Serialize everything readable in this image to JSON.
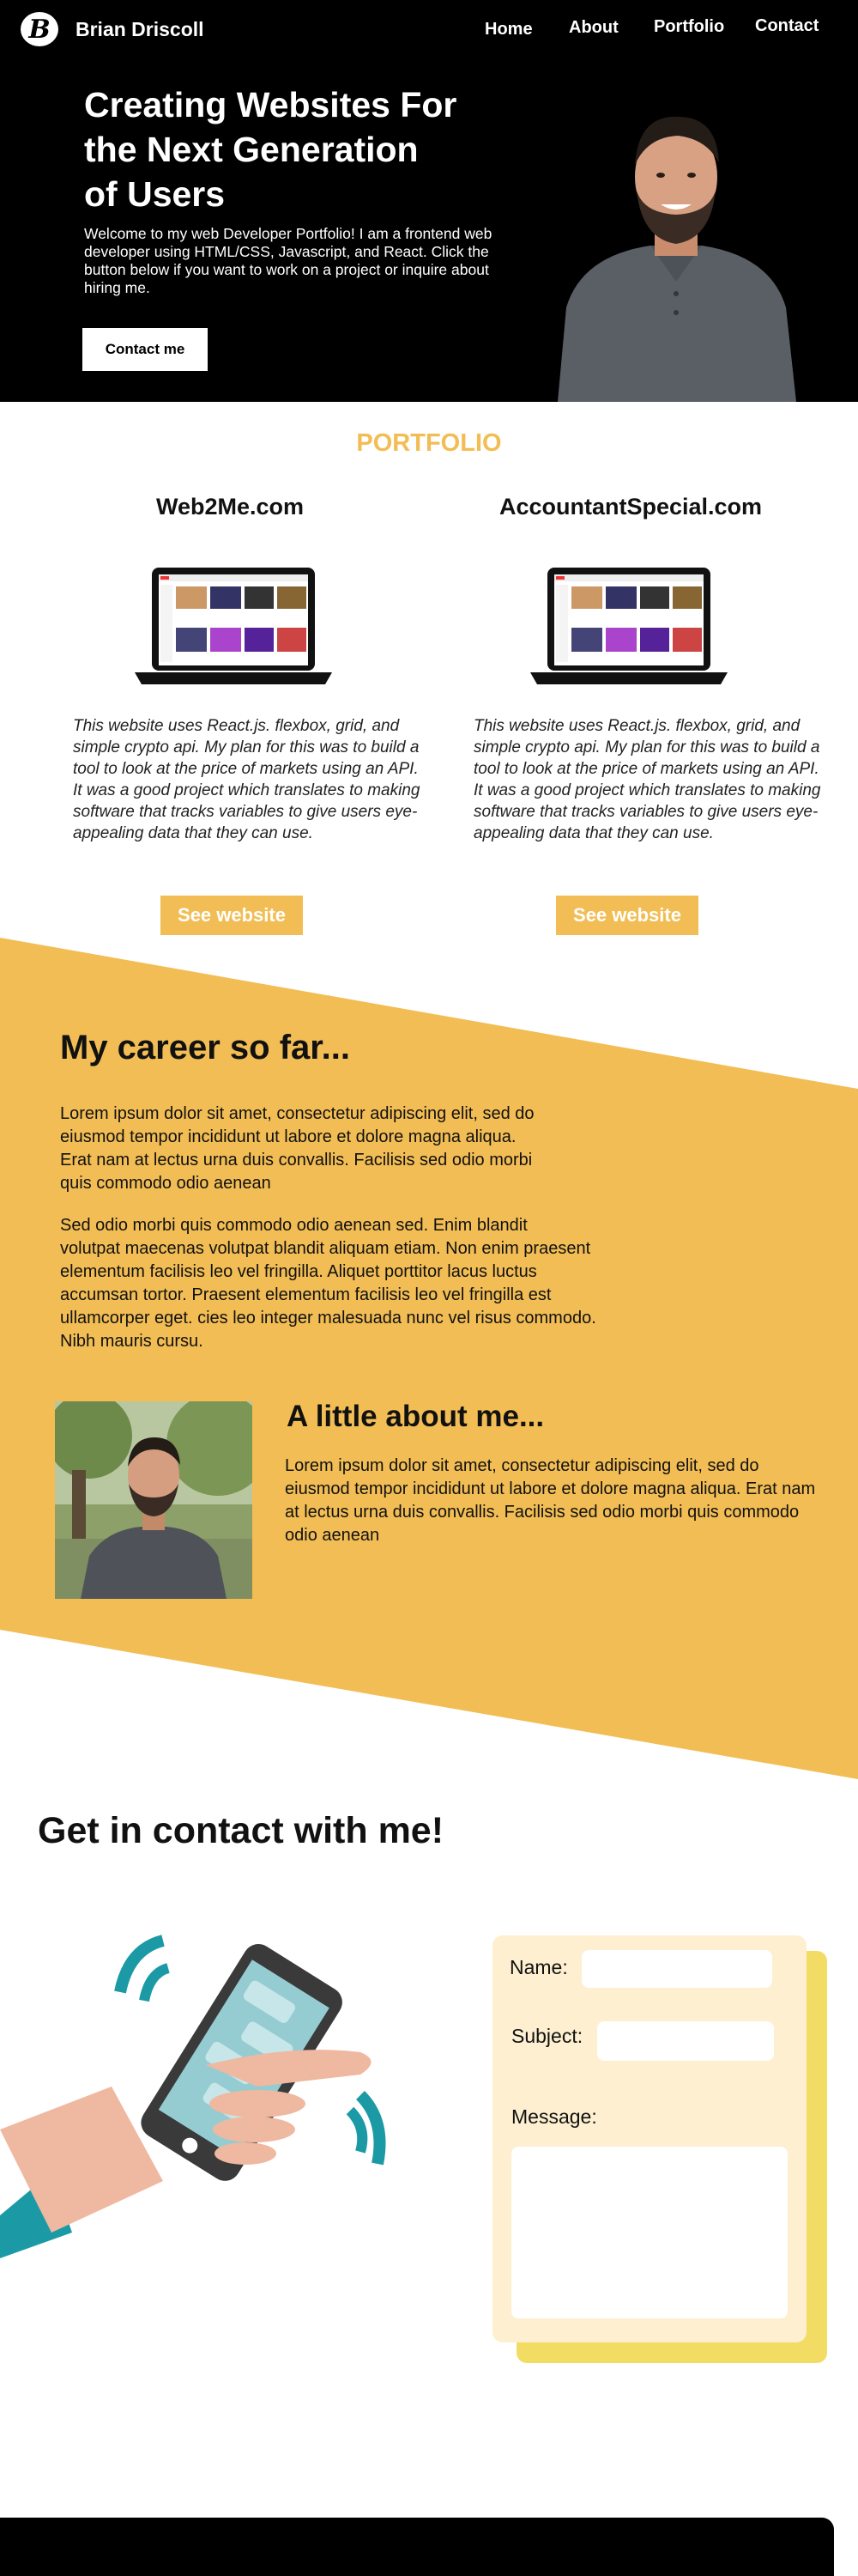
{
  "header": {
    "logo_letter": "B",
    "brand_name": "Brian Driscoll",
    "nav": [
      "Home",
      "About",
      "Portfolio",
      "Contact"
    ]
  },
  "hero": {
    "title_lines": [
      "Creating Websites For",
      "the Next Generation",
      "of Users"
    ],
    "text": "Welcome to my web Developer Portfolio! I am a frontend web developer using HTML/CSS, Javascript, and React. Click the button below if you want to work on a project or inquire about hiring me.",
    "button": "Contact me"
  },
  "portfolio": {
    "title": "PORTFOLIO",
    "projects": [
      {
        "name": "Web2Me.com",
        "description": "This website uses React.js. flexbox, grid, and simple crypto api. My plan for this was to build a tool to look at the price of markets using an API. It was a good project which translates to making software that tracks variables to give users eye-appealing data that they can use.",
        "button": "See website"
      },
      {
        "name": "AccountantSpecial.com",
        "description": "This website uses React.js. flexbox, grid, and simple crypto api. My plan for this was to build a tool to look at the price of markets using an API. It was a good project which translates to making software that tracks variables to give users eye-appealing data that they can use.",
        "button": "See website"
      }
    ]
  },
  "career": {
    "title": "My career so far...",
    "p1": "Lorem ipsum dolor sit amet, consectetur adipiscing elit, sed do\neiusmod tempor incididunt ut labore et dolore magna aliqua.\nErat nam at lectus urna duis convallis. Facilisis sed odio morbi\nquis commodo odio aenean",
    "p2": "Sed odio morbi quis commodo odio aenean sed. Enim blandit\nvolutpat maecenas volutpat blandit aliquam etiam. Non enim praesent\nelementum facilisis leo vel fringilla. Aliquet porttitor lacus luctus\n accumsan tortor. Praesent elementum facilisis leo vel fringilla est\nullamcorper eget. cies leo integer malesuada nunc vel risus commodo.\n Nibh mauris cursu."
  },
  "about": {
    "title": "A little about me...",
    "text": "Lorem ipsum dolor sit amet, consectetur adipiscing elit, sed do eiusmod tempor incididunt ut labore et dolore magna aliqua. Erat nam at lectus urna duis convallis. Facilisis sed odio morbi quis commodo odio aenean"
  },
  "contact": {
    "title": "Get in contact with me!",
    "name_label": "Name:",
    "subject_label": "Subject:",
    "message_label": "Message:"
  },
  "colors": {
    "accent": "#f2bd54",
    "form_bg": "#fdefcf",
    "form_shadow": "#f2dc63",
    "teal": "#1b9aa6"
  }
}
